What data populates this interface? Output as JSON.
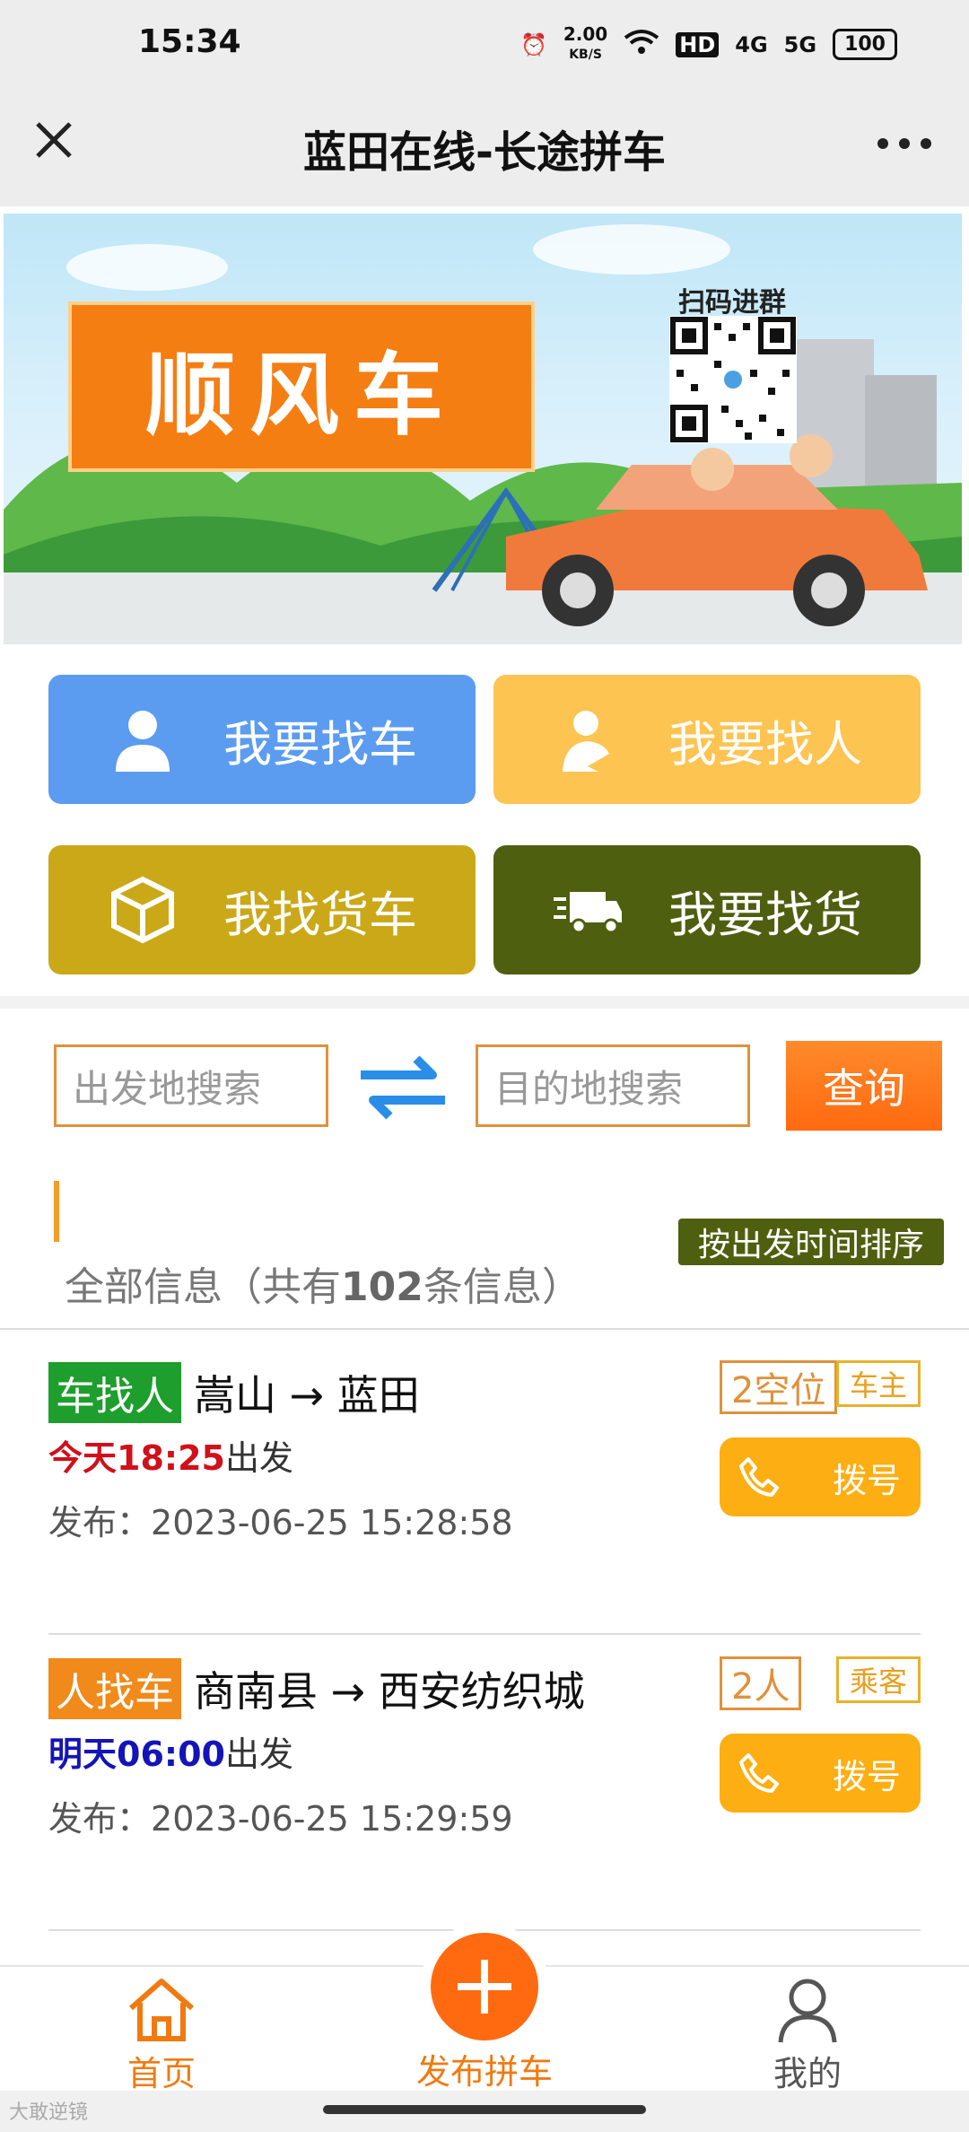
{
  "status_bar": {
    "time": "15:34",
    "speed": "2.00",
    "speed_unit": "KB/S",
    "hd": "HD",
    "net1": "4G",
    "net2": "5G",
    "battery": "100"
  },
  "header": {
    "title": "蓝田在线-长途拼车"
  },
  "banner": {
    "headline": "顺风车",
    "qr_caption": "扫码进群"
  },
  "quick_actions": [
    {
      "label": "我要找车",
      "color": "#5b9cf0"
    },
    {
      "label": "我要找人",
      "color": "#fdc451"
    },
    {
      "label": "我找货车",
      "color": "#caa818"
    },
    {
      "label": "我要找货",
      "color": "#4e5f10"
    }
  ],
  "search": {
    "origin_placeholder": "出发地搜索",
    "destination_placeholder": "目的地搜索",
    "query_label": "查询"
  },
  "list": {
    "sort_label": "按出发时间排序",
    "summary_prefix": "全部信息（共有",
    "total": "102",
    "summary_suffix": "条信息）"
  },
  "listings": [
    {
      "tag": "车找人",
      "tag_color": "#1e9e2c",
      "route": "嵩山 → 蓝田",
      "day": "今天",
      "time": "18:25",
      "time_color": "#d0101a",
      "depart_suffix": "出发",
      "published_label": "发布：",
      "published": "2023-06-25 15:28:58",
      "seats": "2空位",
      "role": "车主",
      "dial": "拨号"
    },
    {
      "tag": "人找车",
      "tag_color": "#f08a1a",
      "route": "商南县 → 西安纺织城",
      "day": "明天",
      "time": "06:00",
      "time_color": "#1414b8",
      "depart_suffix": "出发",
      "published_label": "发布：",
      "published": "2023-06-25 15:29:59",
      "seats": "2人",
      "role": "乘客",
      "dial": "拨号"
    }
  ],
  "tabbar": {
    "home": "首页",
    "publish": "发布拼车",
    "mine": "我的",
    "accent": "#f07a10"
  },
  "watermark": "大敢逆镜"
}
